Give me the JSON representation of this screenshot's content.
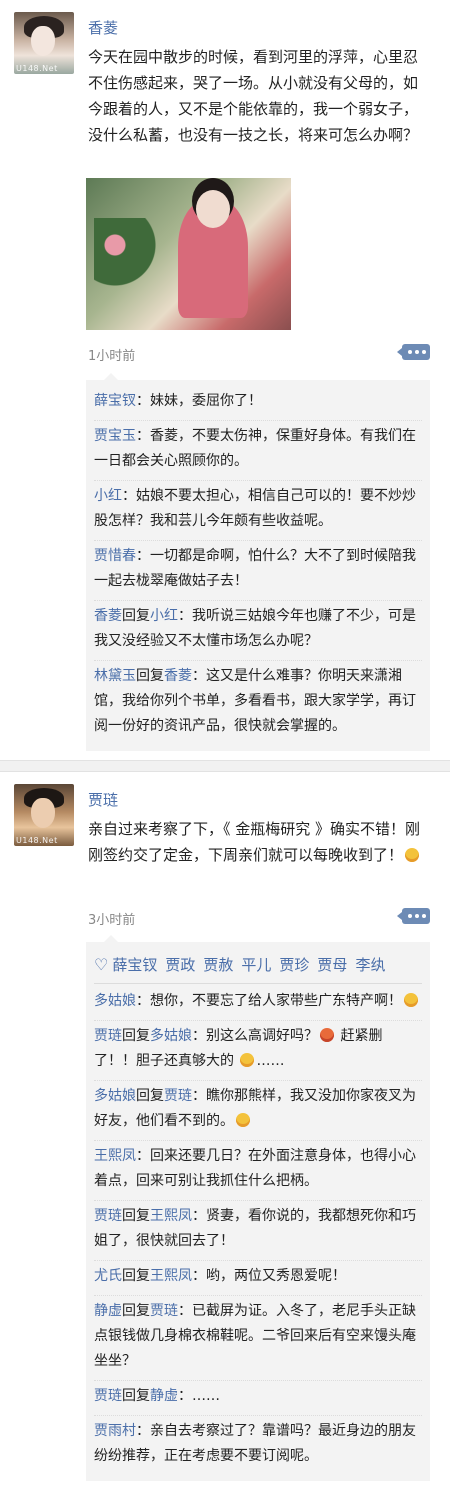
{
  "post1": {
    "author": "香菱",
    "avatar_watermark": "U148.Net",
    "content": "今天在园中散步的时候，看到河里的浮萍，心里忍不住伤感起来，哭了一场。从小就没有父母的，如今跟着的人，又不是个能依靠的，我一个弱女子，没什么私蓄，也没有一技之长，将来可怎么办啊？",
    "time": "1小时前",
    "comments": [
      {
        "user": "薛宝钗",
        "text": "：妹妹，委屈你了！"
      },
      {
        "user": "贾宝玉",
        "text": "：香菱，不要太伤神，保重好身体。有我们在一日都会关心照顾你的。"
      },
      {
        "user": "小红",
        "text": "：姑娘不要太担心，相信自己可以的！要不炒炒股怎样？我和芸儿今年颇有些收益呢。"
      },
      {
        "user": "贾惜春",
        "text": "：一切都是命啊，怕什么？大不了到时候陪我一起去栊翠庵做姑子去！"
      },
      {
        "user": "香菱",
        "reply_label": "回复",
        "reply_to": "小红",
        "text": "：我听说三姑娘今年也赚了不少，可是我又没经验又不太懂市场怎么办呢？"
      },
      {
        "user": "林黛玉",
        "reply_label": "回复",
        "reply_to": "香菱",
        "text": "：这又是什么难事？你明天来潇湘馆，我给你列个书单，多看看书，跟大家学学，再订阅一份好的资讯产品，很快就会掌握的。"
      }
    ]
  },
  "post2": {
    "author": "贾琏",
    "avatar_watermark": "U148.Net",
    "content": "亲自过来考察了下，《 金瓶梅研究 》确实不错！刚刚签约交了定金，下周亲们就可以每晚收到了！",
    "time": "3小时前",
    "likes": [
      "薛宝钗",
      "贾政",
      "贾赦",
      "平儿",
      "贾珍",
      "贾母",
      "李纨"
    ],
    "comments": [
      {
        "user": "多姑娘",
        "text": "：想你，不要忘了给人家带些广东特产啊！"
      },
      {
        "user": "贾琏",
        "reply_label": "回复",
        "reply_to": "多姑娘",
        "text": "：别这么高调好吗？",
        "text2": "赶紧删了！！胆子还真够大的",
        "text3": "……"
      },
      {
        "user": "多姑娘",
        "reply_label": "回复",
        "reply_to": "贾琏",
        "text": "：瞧你那熊样，我又没加你家夜叉为好友，他们看不到的。"
      },
      {
        "user": "王熙凤",
        "text": "：回来还要几日？在外面注意身体，也得小心着点，回来可别让我抓住什么把柄。"
      },
      {
        "user": "贾琏",
        "reply_label": "回复",
        "reply_to": "王熙凤",
        "text": "：贤妻，看你说的，我都想死你和巧姐了，很快就回去了！"
      },
      {
        "user": "尤氏",
        "reply_label": "回复",
        "reply_to": "王熙凤",
        "text": "：哟，两位又秀恩爱呢！"
      },
      {
        "user": "静虚",
        "reply_label": "回复",
        "reply_to": "贾琏",
        "text": "：已截屏为证。入冬了，老尼手头正缺点银钱做几身棉衣棉鞋呢。二爷回来后有空来馒头庵坐坐？"
      },
      {
        "user": "贾琏",
        "reply_label": "回复",
        "reply_to": "静虚",
        "text": "：……"
      },
      {
        "user": "贾雨村",
        "text": "：亲自去考察过了？靠谱吗？最近身边的朋友纷纷推荐，正在考虑要不要订阅呢。"
      }
    ]
  },
  "colors": {
    "name": "#4a6ea9",
    "time": "#888888",
    "comment_bg": "#f3f3f3"
  }
}
